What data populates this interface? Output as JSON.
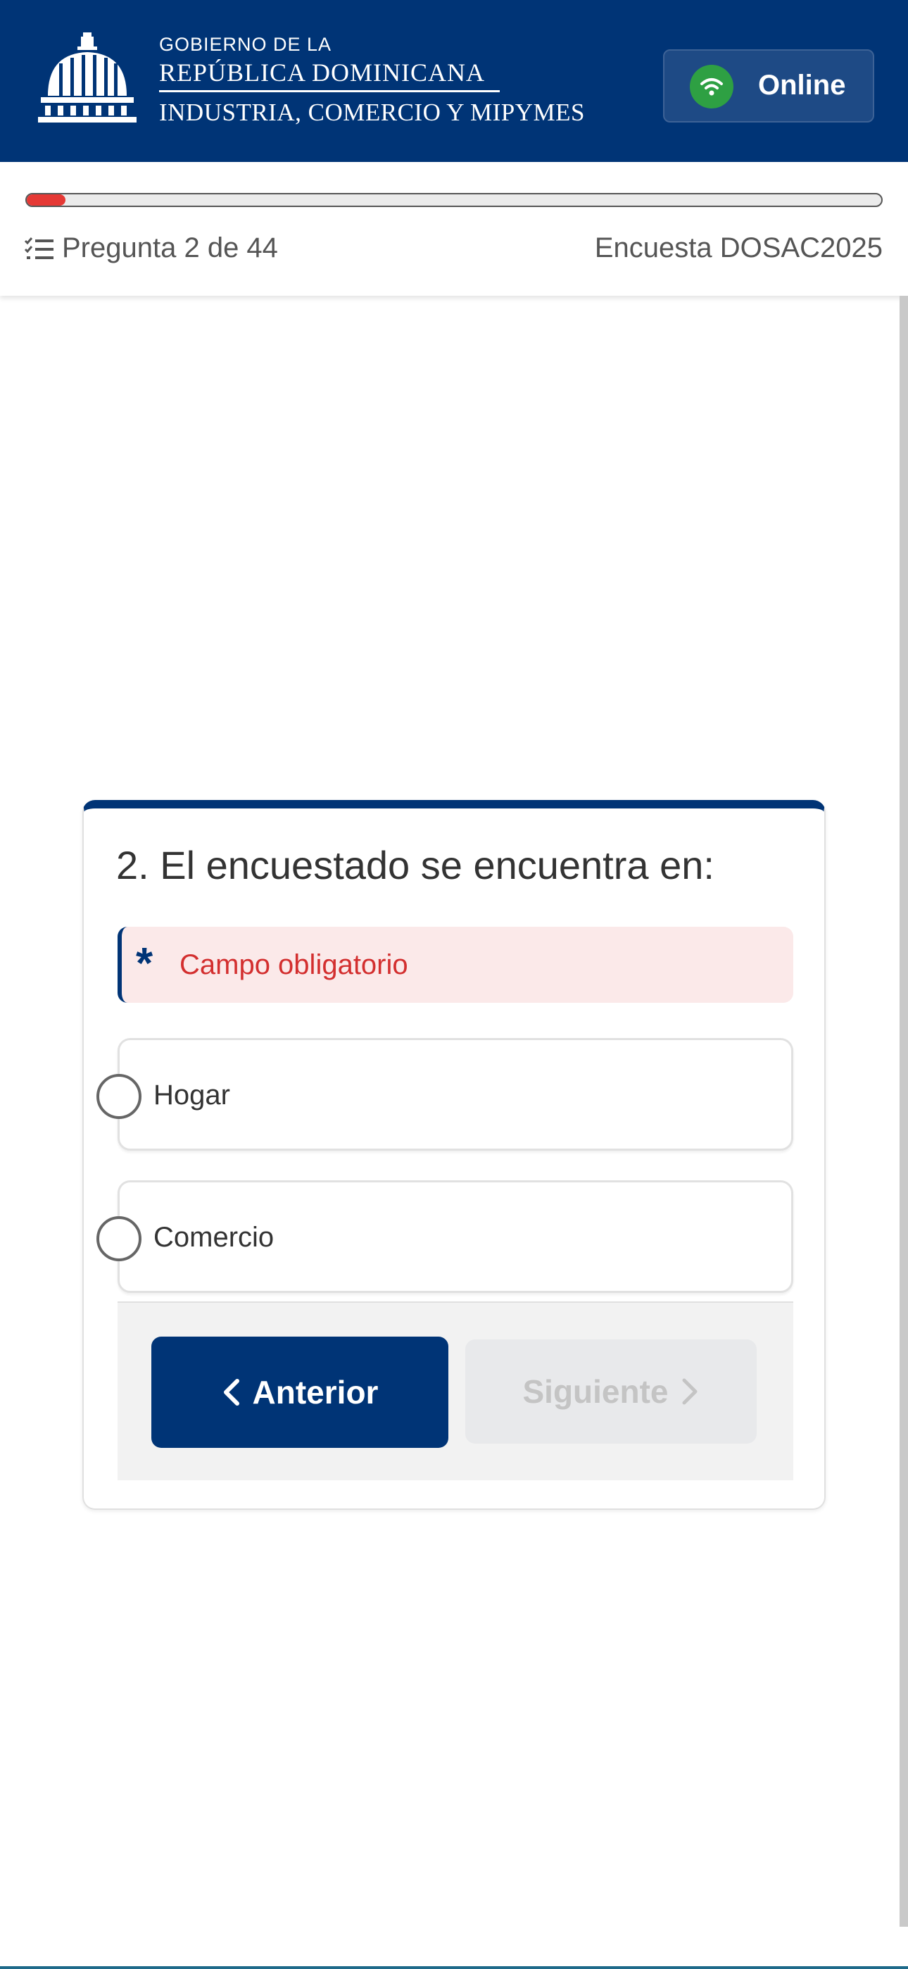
{
  "header": {
    "gov_line1": "GOBIERNO DE LA",
    "gov_line2": "REPÚBLICA DOMINICANA",
    "gov_line3": "INDUSTRIA, COMERCIO Y MIPYMES",
    "status_label": "Online",
    "status_icon": "wifi-icon",
    "status_color": "#2ea043",
    "brand_color": "#003476"
  },
  "progress": {
    "fraction": 0.045,
    "fill_color": "#e53935",
    "counter_text": "Pregunta 2 de 44",
    "survey_name": "Encuesta DOSAC2025"
  },
  "question": {
    "title": "2. El encuestado se encuentra en:",
    "required_marker": "*",
    "required_text": "Campo obligatorio",
    "options": [
      {
        "label": "Hogar",
        "selected": false
      },
      {
        "label": "Comercio",
        "selected": false
      }
    ]
  },
  "navigation": {
    "prev_label": "Anterior",
    "next_label": "Siguiente",
    "next_disabled": true
  }
}
